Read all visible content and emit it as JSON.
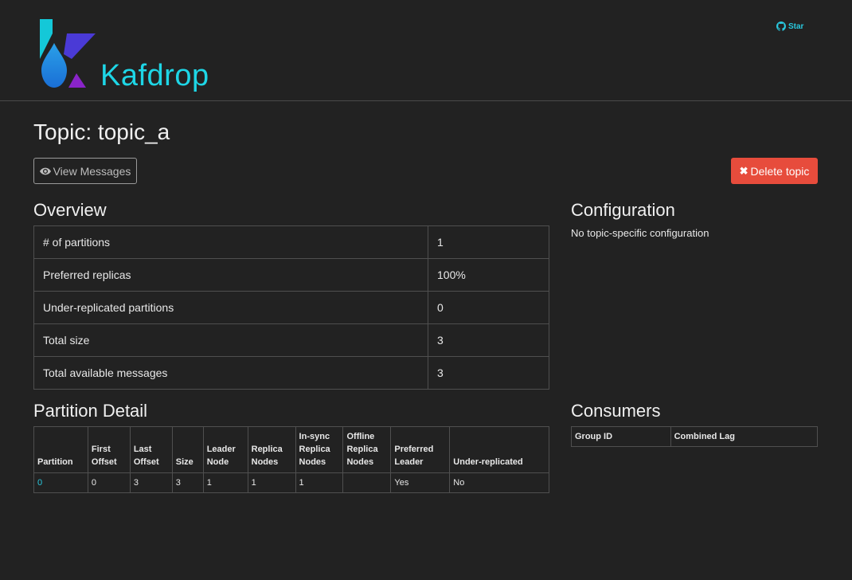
{
  "header": {
    "brand": "Kafdrop",
    "star_label": "Star",
    "accent_color": "#1ed6e6",
    "icons": [
      "kafdrop-logo",
      "github-icon"
    ]
  },
  "page": {
    "title": "Topic: topic_a",
    "view_messages_label": "View Messages",
    "delete_topic_label": "Delete topic",
    "delete_color": "#e74c3c"
  },
  "overview": {
    "heading": "Overview",
    "rows": [
      {
        "label": "# of partitions",
        "value": "1"
      },
      {
        "label": "Preferred replicas",
        "value": "100%"
      },
      {
        "label": "Under-replicated partitions",
        "value": "0"
      },
      {
        "label": "Total size",
        "value": "3"
      },
      {
        "label": "Total available messages",
        "value": "3"
      }
    ]
  },
  "configuration": {
    "heading": "Configuration",
    "text": "No topic-specific configuration"
  },
  "partition_detail": {
    "heading": "Partition Detail",
    "columns": [
      [
        "Partition"
      ],
      [
        "First",
        "Offset"
      ],
      [
        "Last",
        "Offset"
      ],
      [
        "Size"
      ],
      [
        "Leader",
        "Node"
      ],
      [
        "Replica",
        "Nodes"
      ],
      [
        "In-sync",
        "Replica",
        "Nodes"
      ],
      [
        "Offline",
        "Replica",
        "Nodes"
      ],
      [
        "Preferred",
        "Leader"
      ],
      [
        "Under-replicated"
      ]
    ],
    "rows": [
      [
        "0",
        "0",
        "3",
        "3",
        "1",
        "1",
        "1",
        "",
        "Yes",
        "No"
      ]
    ]
  },
  "consumers": {
    "heading": "Consumers",
    "columns": [
      "Group ID",
      "Combined Lag"
    ]
  }
}
